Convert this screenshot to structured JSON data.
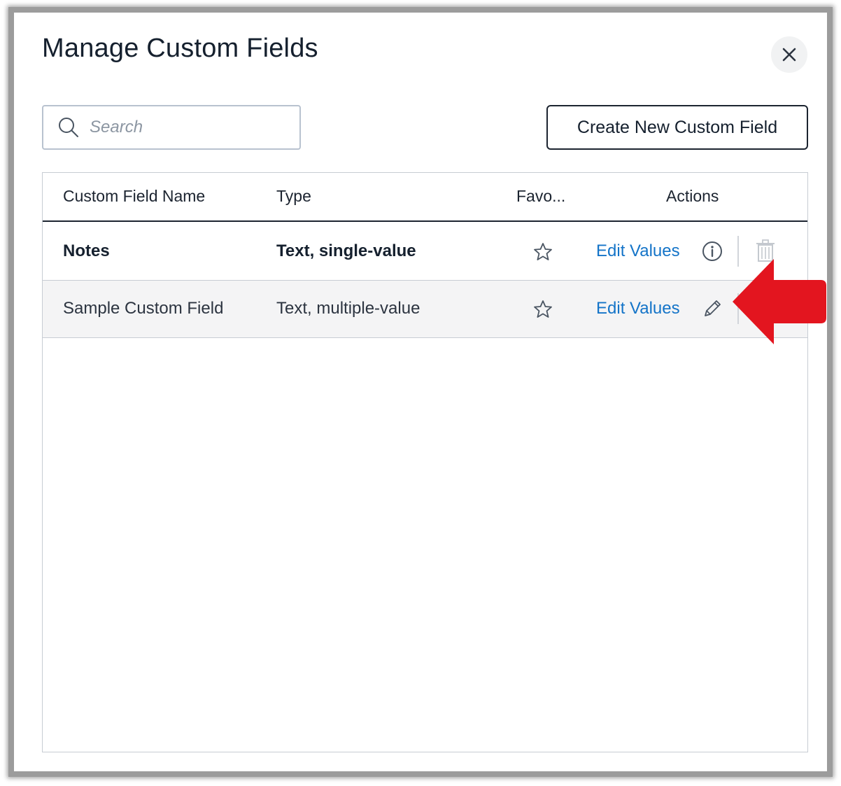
{
  "dialog": {
    "title": "Manage Custom Fields",
    "close_icon": "close-icon"
  },
  "search": {
    "placeholder": "Search",
    "icon": "search-icon"
  },
  "toolbar": {
    "create_label": "Create New Custom Field"
  },
  "table": {
    "columns": [
      "Custom Field Name",
      "Type",
      "Favo...",
      "Actions"
    ],
    "rows": [
      {
        "name": "Notes",
        "type": "Text, single-value",
        "favorite_icon": "star-outline-icon",
        "edit_label": "Edit Values",
        "action_icon": "info-icon",
        "delete_icon": "trash-icon",
        "delete_enabled": false,
        "selected": false
      },
      {
        "name": "Sample Custom Field",
        "type": "Text, multiple-value",
        "favorite_icon": "star-outline-icon",
        "edit_label": "Edit Values",
        "action_icon": "pencil-icon",
        "selected": true
      }
    ]
  },
  "annotation": {
    "arrow_color": "#e3151f",
    "points_to": "pencil-icon"
  },
  "colors": {
    "link": "#1474c8",
    "text_dark": "#15202e",
    "row_highlight": "#f4f4f5",
    "border": "#c7ccd3"
  }
}
